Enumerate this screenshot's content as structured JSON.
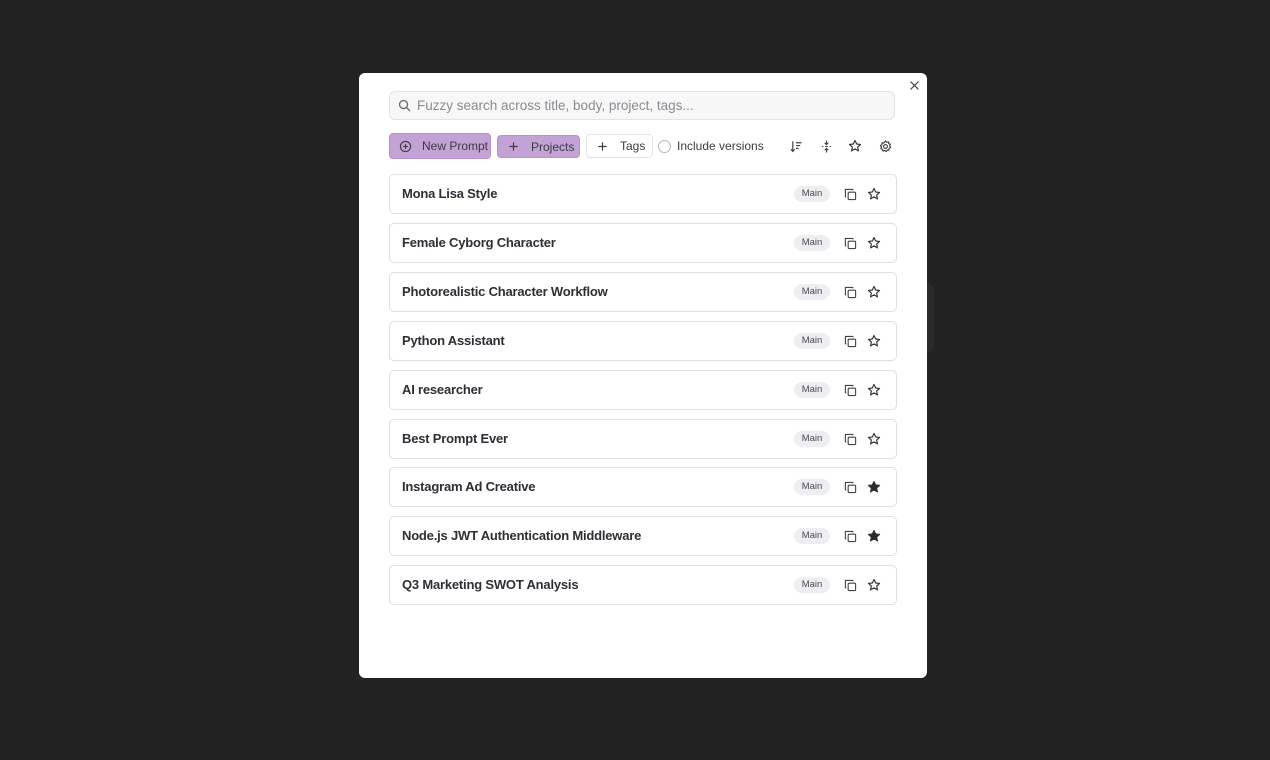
{
  "search": {
    "placeholder": "Fuzzy search across title, body, project, tags...",
    "value": ""
  },
  "toolbar": {
    "new_prompt_label": "New Prompt",
    "projects_label": "Projects",
    "tags_label": "Tags",
    "include_versions_label": "Include versions",
    "include_versions_checked": false,
    "icons": [
      "sort-icon",
      "compress-icon",
      "star-icon",
      "gear-icon"
    ]
  },
  "prompts": [
    {
      "title": "Mona Lisa Style",
      "badge": "Main",
      "favorite": false
    },
    {
      "title": "Female Cyborg Character",
      "badge": "Main",
      "favorite": false
    },
    {
      "title": "Photorealistic Character Workflow",
      "badge": "Main",
      "favorite": false
    },
    {
      "title": "Python Assistant",
      "badge": "Main",
      "favorite": false
    },
    {
      "title": "AI researcher",
      "badge": "Main",
      "favorite": false
    },
    {
      "title": "Best Prompt Ever",
      "badge": "Main",
      "favorite": false
    },
    {
      "title": "Instagram Ad Creative",
      "badge": "Main",
      "favorite": true
    },
    {
      "title": "Node.js JWT Authentication Middleware",
      "badge": "Main",
      "favorite": true
    },
    {
      "title": "Q3 Marketing SWOT Analysis",
      "badge": "Main",
      "favorite": false
    }
  ],
  "colors": {
    "backdrop": "#222222",
    "accent": "#c3a3d6",
    "badge_bg": "#eeeef1",
    "border": "#dedee3"
  }
}
